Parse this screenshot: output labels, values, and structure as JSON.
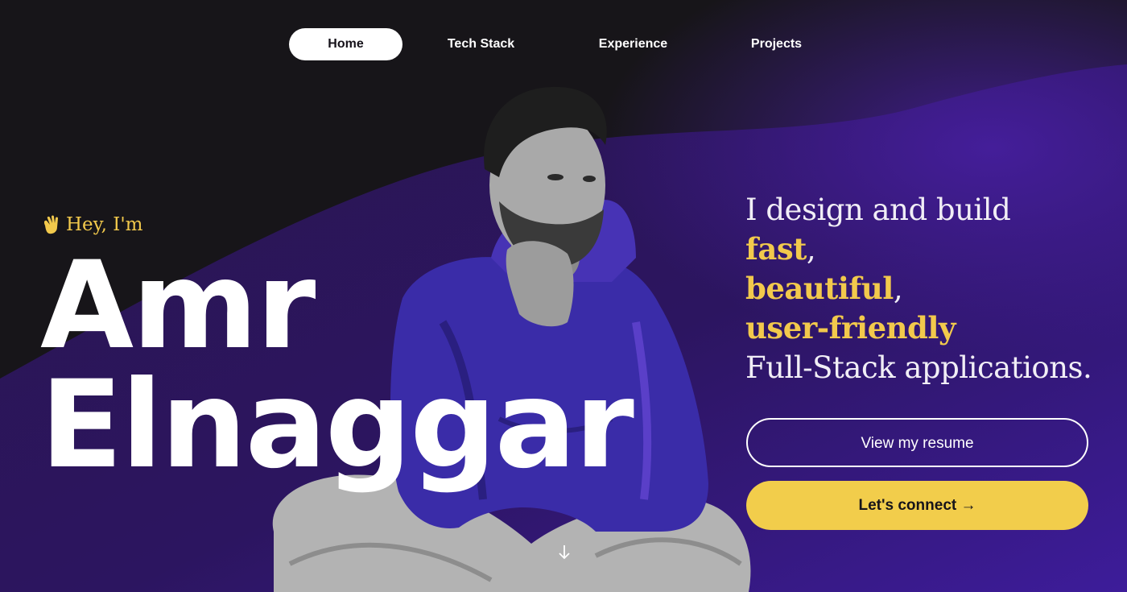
{
  "nav": {
    "items": [
      {
        "label": "Home",
        "active": true
      },
      {
        "label": "Tech Stack",
        "active": false
      },
      {
        "label": "Experience",
        "active": false
      },
      {
        "label": "Projects",
        "active": false
      }
    ]
  },
  "hero": {
    "greeting": "Hey, I'm",
    "greeting_icon": "waving-hand-icon",
    "name_first": "Amr",
    "name_last": "Elnaggar"
  },
  "tagline": {
    "line1": "I design and build",
    "highlight1": "fast",
    "sep1": ",",
    "highlight2": "beautiful",
    "sep2": ",",
    "highlight3": "user-friendly",
    "line5": "Full-Stack applications."
  },
  "actions": {
    "resume_label": "View my resume",
    "connect_label": "Let's connect →"
  },
  "scroll_hint_icon": "arrow-down-icon",
  "colors": {
    "background": "#171519",
    "accent_purple": "#3a1a8a",
    "accent_yellow": "#f2c94c",
    "text": "#ffffff"
  }
}
